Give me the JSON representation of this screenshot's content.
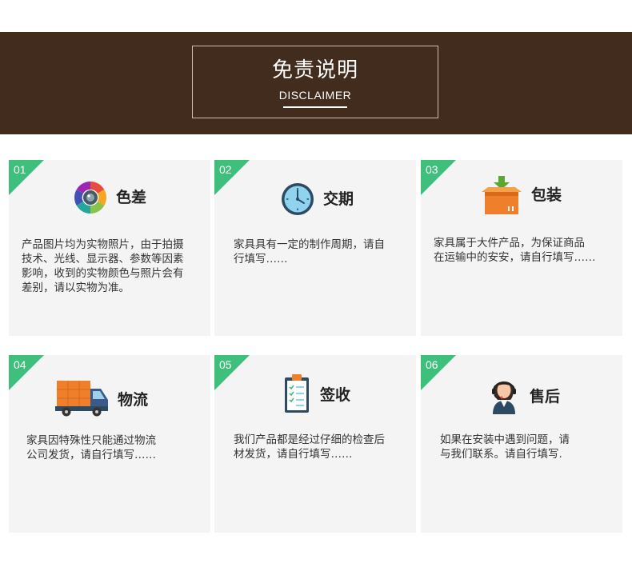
{
  "header": {
    "title": "免责说明",
    "subtitle": "DISCLAIMER"
  },
  "cards": [
    {
      "num": "01",
      "title": "色差",
      "icon": "color-wheel-icon",
      "lines": [
        "产品图片均为实物照片，由于拍摄",
        "技术、光线、显示器、参数等因素",
        "影响，收到的实物颜色与照片会有",
        "差别，请以实物为准。"
      ]
    },
    {
      "num": "02",
      "title": "交期",
      "icon": "clock-icon",
      "lines": [
        "家具具有一定的制作周期，请自",
        "行填写……"
      ]
    },
    {
      "num": "03",
      "title": "包装",
      "icon": "package-box-icon",
      "lines": [
        "家具属于大件产品，为保证商品",
        "在运输中的安安，请自行填写……"
      ]
    },
    {
      "num": "04",
      "title": "物流",
      "icon": "delivery-truck-icon",
      "lines": [
        "家具因特殊性只能通过物流",
        "公司发货，请自行填写……"
      ]
    },
    {
      "num": "05",
      "title": "签收",
      "icon": "checklist-clipboard-icon",
      "lines": [
        "我们产品都是经过仔细的检查后",
        "材发货，请自行填写……"
      ]
    },
    {
      "num": "06",
      "title": "售后",
      "icon": "customer-service-icon",
      "lines": [
        "如果在安装中遇到问题，请",
        "与我们联系。请自行填写."
      ]
    }
  ],
  "colors": {
    "banner_bg": "#412c1e",
    "card_bg": "#f4f4f4",
    "accent_green": "#3fbf7c"
  }
}
